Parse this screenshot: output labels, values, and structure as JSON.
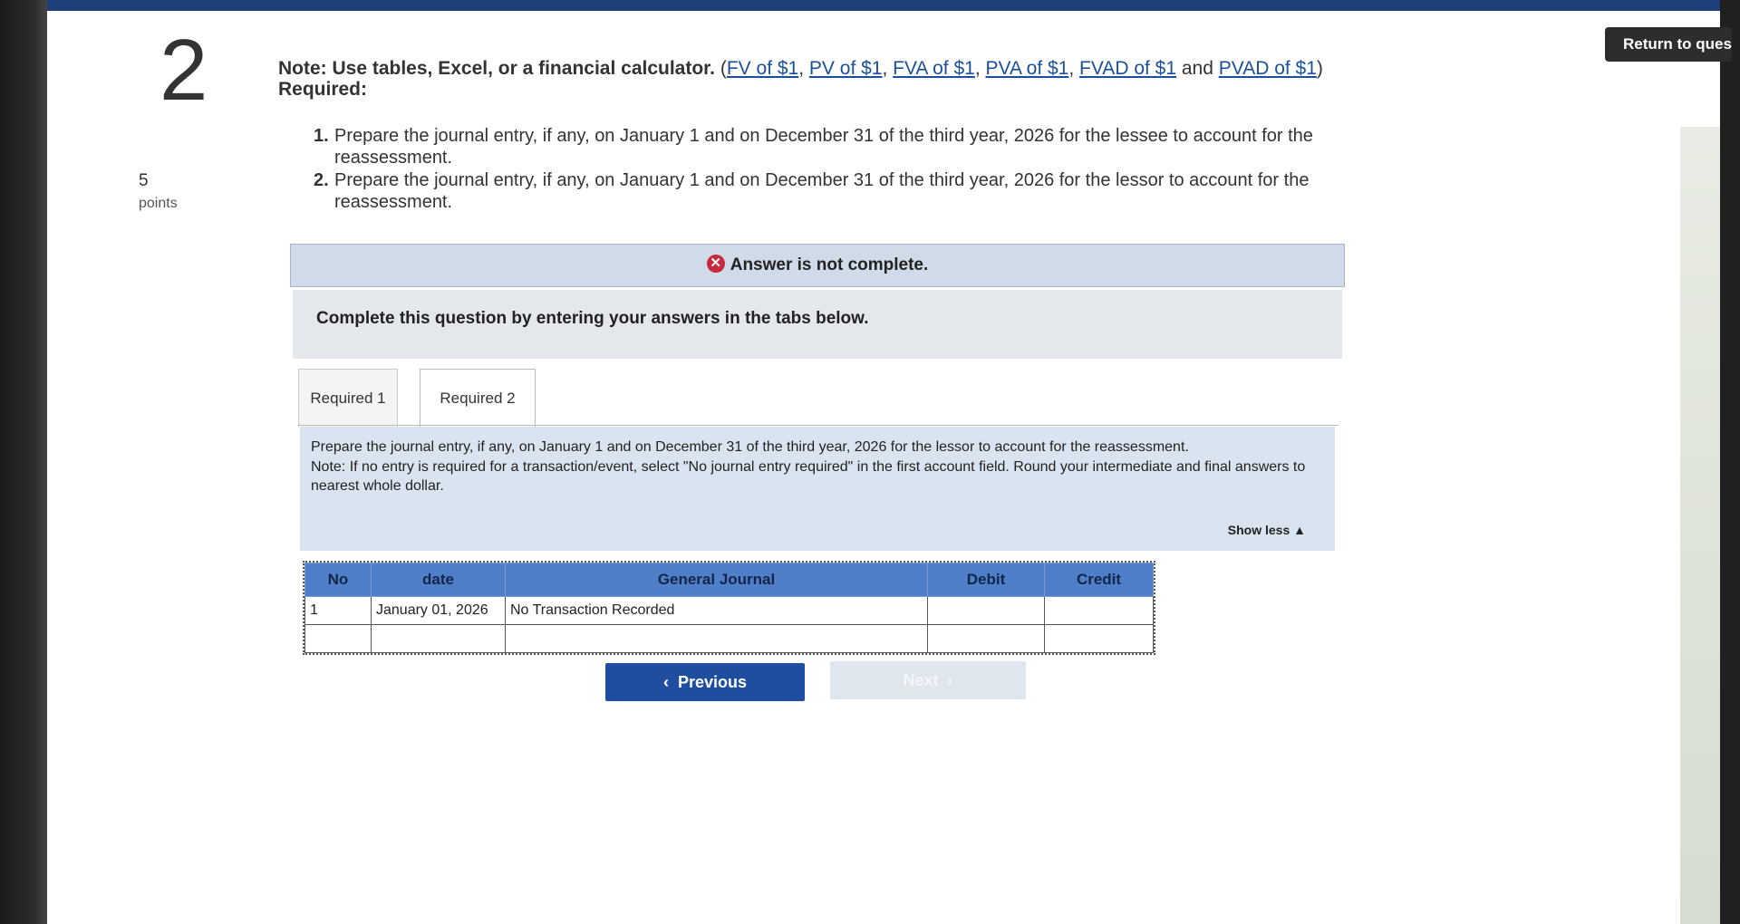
{
  "return_button": {
    "label": "Return to quest"
  },
  "question": {
    "number": "2",
    "points_value": "5",
    "points_label": "points"
  },
  "note": {
    "prefix": "Note: Use tables, Excel, or a financial calculator.",
    "open": "(",
    "links": [
      "FV of $1",
      "PV of $1",
      "FVA of $1",
      "PVA of $1",
      "FVAD of $1",
      "PVAD of $1"
    ],
    "sep": ", ",
    "and": " and ",
    "close": ")"
  },
  "required_header": "Required:",
  "requirements": [
    {
      "num": "1.",
      "text": "Prepare the journal entry, if any, on January 1 and on December 31 of the third year, 2026 for the lessee to account for the reassessment."
    },
    {
      "num": "2.",
      "text": "Prepare the journal entry, if any, on January 1 and on December 31 of the third year, 2026 for the lessor to account for the reassessment."
    }
  ],
  "banner": {
    "icon": "x-circle-icon",
    "text": "Answer is not complete."
  },
  "instructions": "Complete this question by entering your answers in the tabs below.",
  "tabs": [
    {
      "label": "Required 1",
      "active": false
    },
    {
      "label": "Required 2",
      "active": true
    }
  ],
  "content": {
    "prompt": "Prepare the journal entry, if any, on January 1 and on December 31 of the third year, 2026 for the lessor to account for the reassessment.",
    "note": "Note: If no entry is required for a transaction/event, select \"No journal entry required\" in the first account field. Round your intermediate and final answers to nearest whole dollar.",
    "show_less": "Show less ▲"
  },
  "journal": {
    "columns": [
      "No",
      "date",
      "General Journal",
      "Debit",
      "Credit"
    ],
    "rows": [
      [
        "1",
        "January 01, 2026",
        "No Transaction Recorded",
        "",
        ""
      ],
      [
        "",
        "",
        "",
        "",
        ""
      ]
    ]
  },
  "nav": {
    "previous": "Previous",
    "previous_icon": "chevron-left-icon",
    "next": "Next"
  },
  "colors": {
    "header_blue": "#4f7fc8",
    "button_blue": "#1f4ea1",
    "error_red": "#c8283c"
  }
}
